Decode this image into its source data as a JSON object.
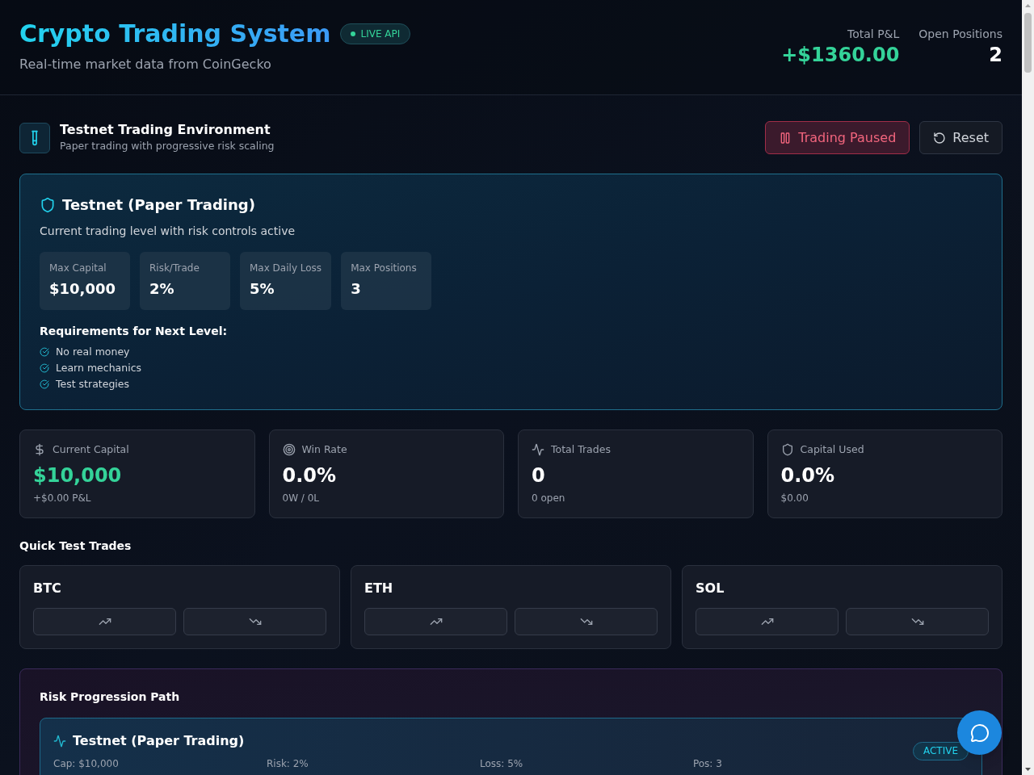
{
  "header": {
    "title": "Crypto Trading System",
    "badge": {
      "label": "LIVE API",
      "live": true
    },
    "subtitle": "Real-time market data from CoinGecko",
    "summary": [
      {
        "kind": "pnl",
        "label": "Total P&L",
        "value": "+$1360.00"
      },
      {
        "kind": "count",
        "label": "Open Positions",
        "value": "2"
      }
    ]
  },
  "environment": {
    "title": "Testnet Trading Environment",
    "subtitle": "Paper trading with progressive risk scaling",
    "buttons": [
      {
        "kind": "pause",
        "label": "Trading Paused"
      },
      {
        "kind": "reset",
        "label": "Reset"
      }
    ]
  },
  "current_level": {
    "title": "Testnet (Paper Trading)",
    "description": "Current trading level with risk controls active",
    "limits": [
      {
        "label": "Max Capital",
        "value": "$10,000"
      },
      {
        "label": "Risk/Trade",
        "value": "2%"
      },
      {
        "label": "Max Daily Loss",
        "value": "5%"
      },
      {
        "label": "Max Positions",
        "value": "3"
      }
    ],
    "requirements_title": "Requirements for Next Level:",
    "requirements": [
      {
        "label": "No real money",
        "checked": true
      },
      {
        "label": "Learn mechanics",
        "checked": true
      },
      {
        "label": "Test strategies",
        "checked": true
      }
    ]
  },
  "metrics": [
    {
      "kind": "dollar",
      "label": "Current Capital",
      "value": "$10,000",
      "detail": "+$0.00 P&L",
      "highlight": true
    },
    {
      "kind": "target",
      "label": "Win Rate",
      "value": "0.0%",
      "detail": "0W / 0L",
      "highlight": false
    },
    {
      "kind": "activity",
      "label": "Total Trades",
      "value": "0",
      "detail": "0 open",
      "highlight": false
    },
    {
      "kind": "shield",
      "label": "Capital Used",
      "value": "0.0%",
      "detail": "$0.00",
      "highlight": false
    }
  ],
  "quick_trades": {
    "title": "Quick Test Trades",
    "assets": [
      {
        "symbol": "BTC"
      },
      {
        "symbol": "ETH"
      },
      {
        "symbol": "SOL"
      }
    ]
  },
  "risk_path": {
    "title": "Risk Progression Path",
    "levels": [
      {
        "title": "Testnet (Paper Trading)",
        "active": true,
        "badge": "ACTIVE",
        "limits": [
          "Cap: $10,000",
          "Risk: 2%",
          "Loss: 5%",
          "Pos: 3"
        ]
      }
    ]
  }
}
